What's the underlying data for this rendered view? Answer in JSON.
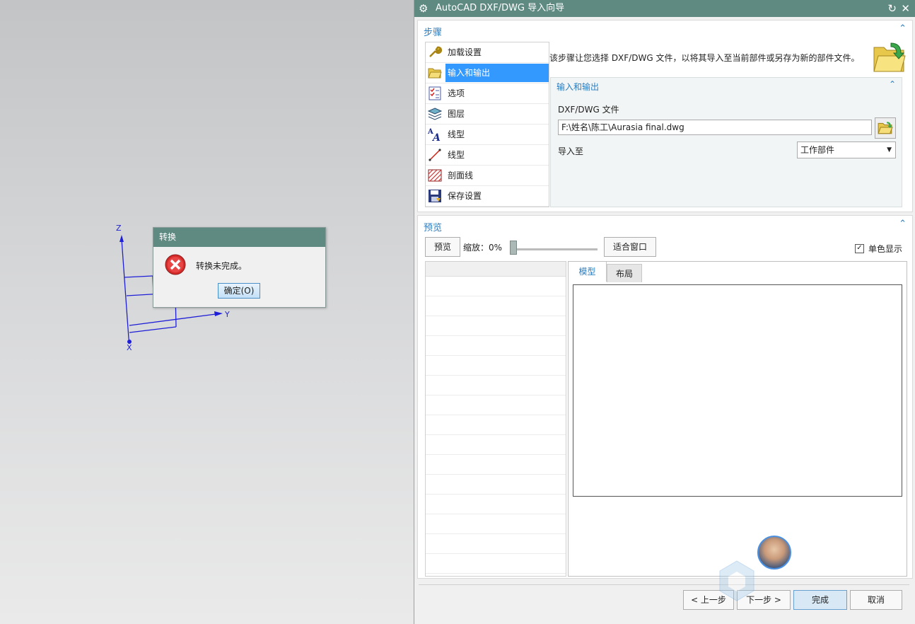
{
  "viewport": {
    "axes": {
      "z": "Z",
      "y": "Y",
      "x": "X"
    },
    "message_box": {
      "title": "转换",
      "message": "转换未完成。",
      "ok_label": "确定(O)",
      "icon": "error-icon"
    }
  },
  "wizard": {
    "title": "AutoCAD DXF/DWG 导入向导",
    "steps_section": {
      "header": "步骤",
      "items": [
        {
          "label": "加载设置",
          "icon": "wrench-icon"
        },
        {
          "label": "输入和输出",
          "icon": "folder-open-icon",
          "selected": true
        },
        {
          "label": "选项",
          "icon": "checklist-icon"
        },
        {
          "label": "图层",
          "icon": "layers-icon"
        },
        {
          "label": "线型",
          "icon": "font-icon"
        },
        {
          "label": "线型",
          "icon": "line-icon"
        },
        {
          "label": "剖面线",
          "icon": "hatch-icon"
        },
        {
          "label": "保存设置",
          "icon": "save-icon"
        }
      ],
      "description": "该步骤让您选择 DXF/DWG 文件，以将其导入至当前部件或另存为新的部件文件。",
      "io_group": {
        "header": "输入和输出",
        "file_label": "DXF/DWG 文件",
        "file_value": "F:\\姓名\\陈工\\Aurasia final.dwg",
        "import_to_label": "导入至",
        "import_to_value": "工作部件"
      }
    },
    "preview_section": {
      "header": "预览",
      "preview_button": "预览",
      "zoom_label": "缩放：0%",
      "zoom_value": 0,
      "fit_button": "适合窗口",
      "mono_label": "单色显示",
      "mono_checked": true,
      "tabs": [
        "模型",
        "布局"
      ]
    },
    "buttons": {
      "back": "< 上一步",
      "next": "下一步 >",
      "finish": "完成",
      "cancel": "取消"
    }
  },
  "colors": {
    "title_bar": "#5f8a82",
    "accent": "#2b7dbf",
    "selected": "#3399ff"
  }
}
